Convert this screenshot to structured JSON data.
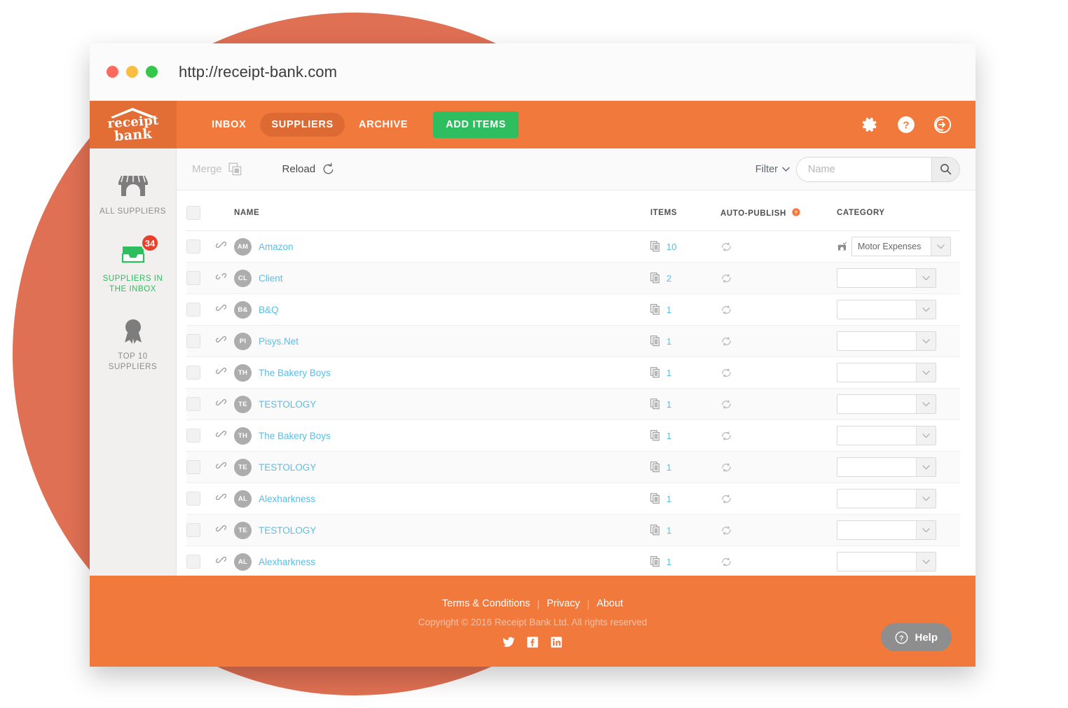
{
  "browser": {
    "url": "http://receipt-bank.com",
    "traffic_lights": [
      "close",
      "minimize",
      "maximize"
    ]
  },
  "header": {
    "logo_line1": "receipt",
    "logo_line2": "bank",
    "tabs": [
      {
        "label": "INBOX",
        "active": false
      },
      {
        "label": "SUPPLIERS",
        "active": true
      },
      {
        "label": "ARCHIVE",
        "active": false
      }
    ],
    "add_items_label": "ADD ITEMS",
    "icons": [
      "gear-icon",
      "help-icon",
      "logout-icon"
    ]
  },
  "sidebar": {
    "items": [
      {
        "label": "ALL SUPPLIERS",
        "icon": "shop-icon",
        "active": false,
        "badge": null
      },
      {
        "label": "SUPPLIERS IN\nTHE INBOX",
        "label_line1": "SUPPLIERS IN",
        "label_line2": "THE INBOX",
        "icon": "inbox-icon",
        "active": true,
        "badge": "34"
      },
      {
        "label": "TOP 10\nSUPPLIERS",
        "label_line1": "TOP 10",
        "label_line2": "SUPPLIERS",
        "icon": "award-icon",
        "active": false,
        "badge": null
      }
    ]
  },
  "toolbar": {
    "merge_label": "Merge",
    "reload_label": "Reload",
    "filter_label": "Filter",
    "search_placeholder": "Name",
    "search_value": ""
  },
  "table": {
    "headers": {
      "name": "NAME",
      "items": "ITEMS",
      "auto_publish": "AUTO-PUBLISH",
      "category": "CATEGORY"
    },
    "rows": [
      {
        "initials": "AM",
        "name": "Amazon",
        "items": "10",
        "category": "Motor Expenses",
        "has_category_icon": true,
        "link_broken": false
      },
      {
        "initials": "CL",
        "name": "Client",
        "items": "2",
        "category": "",
        "has_category_icon": false,
        "link_broken": true
      },
      {
        "initials": "B&",
        "name": "B&Q",
        "items": "1",
        "category": "",
        "has_category_icon": false,
        "link_broken": false
      },
      {
        "initials": "PI",
        "name": "Pisys.Net",
        "items": "1",
        "category": "",
        "has_category_icon": false,
        "link_broken": false
      },
      {
        "initials": "TH",
        "name": "The Bakery Boys",
        "items": "1",
        "category": "",
        "has_category_icon": false,
        "link_broken": false
      },
      {
        "initials": "TE",
        "name": "TESTOLOGY",
        "items": "1",
        "category": "",
        "has_category_icon": false,
        "link_broken": false
      },
      {
        "initials": "TH",
        "name": "The Bakery Boys",
        "items": "1",
        "category": "",
        "has_category_icon": false,
        "link_broken": false
      },
      {
        "initials": "TE",
        "name": "TESTOLOGY",
        "items": "1",
        "category": "",
        "has_category_icon": false,
        "link_broken": false
      },
      {
        "initials": "AL",
        "name": "Alexharkness",
        "items": "1",
        "category": "",
        "has_category_icon": false,
        "link_broken": false
      },
      {
        "initials": "TE",
        "name": "TESTOLOGY",
        "items": "1",
        "category": "",
        "has_category_icon": false,
        "link_broken": false
      },
      {
        "initials": "AL",
        "name": "Alexharkness",
        "items": "1",
        "category": "",
        "has_category_icon": false,
        "link_broken": false
      }
    ]
  },
  "footer": {
    "links": [
      "Terms & Conditions",
      "Privacy",
      "About"
    ],
    "separator": "|",
    "copyright": "Copyright © 2016 Receipt Bank Ltd. All rights reserved",
    "social": [
      "twitter-icon",
      "facebook-icon",
      "linkedin-icon"
    ],
    "help_label": "Help"
  },
  "colors": {
    "brand_orange": "#F2793C",
    "logo_block": "#E26E35",
    "active_tab": "#DE6A33",
    "green": "#2EBD5F",
    "link_blue": "#5ABEE8",
    "badge_red": "#E8402A",
    "backdrop_circle": "#E07053"
  }
}
